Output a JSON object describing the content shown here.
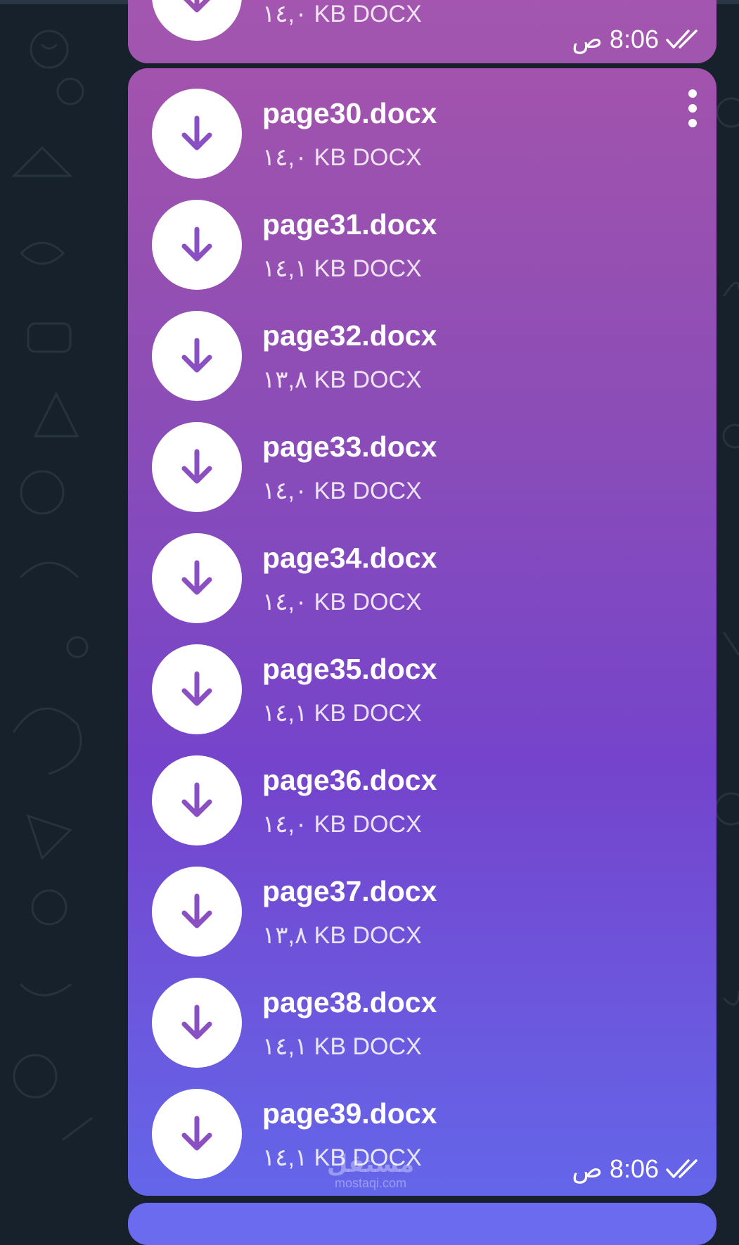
{
  "colors": {
    "background": "#17212b",
    "bubble_top": "#a253ad",
    "bubble_bottom": "#6466ea",
    "icon_accent": "#8a4fc0"
  },
  "previous_message": {
    "file_size": "١٤,٠ KB DOCX",
    "time": "8:06 ص"
  },
  "message": {
    "time": "8:06 ص",
    "files": [
      {
        "name": "page30.docx",
        "size": "١٤,٠ KB DOCX"
      },
      {
        "name": "page31.docx",
        "size": "١٤,١ KB DOCX"
      },
      {
        "name": "page32.docx",
        "size": "١٣,٨ KB DOCX"
      },
      {
        "name": "page33.docx",
        "size": "١٤,٠ KB DOCX"
      },
      {
        "name": "page34.docx",
        "size": "١٤,٠ KB DOCX"
      },
      {
        "name": "page35.docx",
        "size": "١٤,١ KB DOCX"
      },
      {
        "name": "page36.docx",
        "size": "١٤,٠ KB DOCX"
      },
      {
        "name": "page37.docx",
        "size": "١٣,٨ KB DOCX"
      },
      {
        "name": "page38.docx",
        "size": "١٤,١ KB DOCX"
      },
      {
        "name": "page39.docx",
        "size": "١٤,١ KB DOCX"
      }
    ]
  },
  "watermark": {
    "logo_text": "مستقل",
    "site": "mostaqi.com"
  }
}
